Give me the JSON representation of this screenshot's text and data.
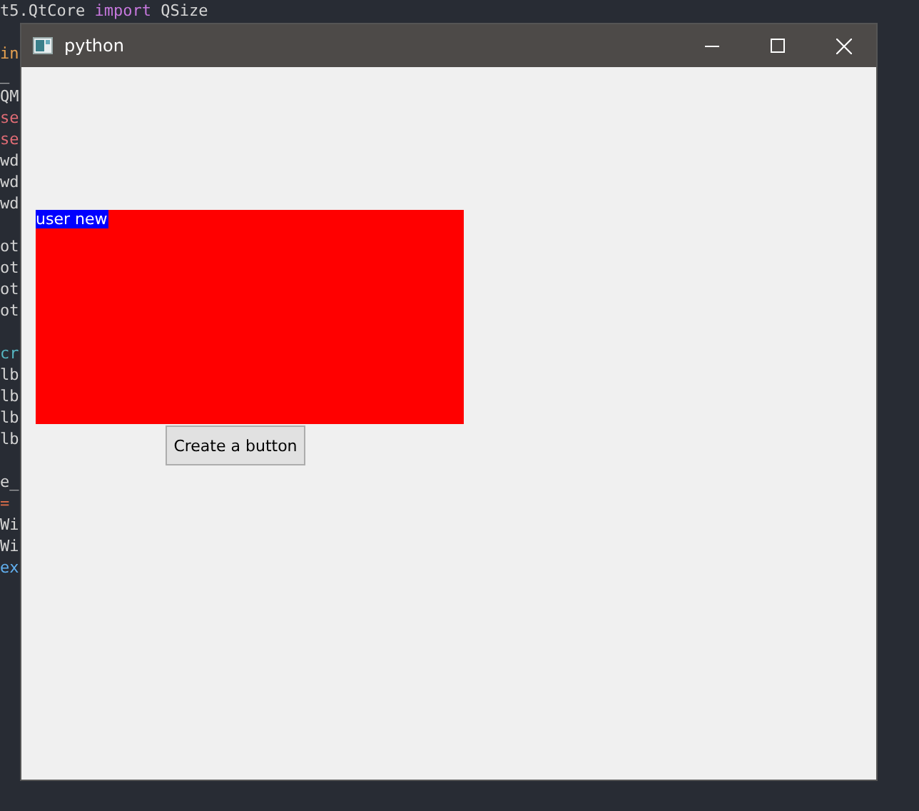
{
  "editor": {
    "first_line": [
      {
        "text": "t5.QtCore ",
        "color": "#d4d4d4"
      },
      {
        "text": "import",
        "color": "#c678dd"
      },
      {
        "text": " QSize",
        "color": "#d4d4d4"
      }
    ],
    "lines": [
      {
        "kind": "blank"
      },
      {
        "kind": "code",
        "text": "in",
        "color": "#e5a050"
      },
      {
        "kind": "code",
        "text": "_"
      },
      {
        "kind": "code",
        "text": "QM",
        "color": "#d4d4d4"
      },
      {
        "kind": "code",
        "text": "se",
        "color": "#e06c75"
      },
      {
        "kind": "code",
        "text": "se",
        "color": "#e06c75"
      },
      {
        "kind": "code",
        "text": "wd",
        "color": "#d4d4d4"
      },
      {
        "kind": "code",
        "text": "wd",
        "color": "#d4d4d4"
      },
      {
        "kind": "code",
        "text": "wd",
        "color": "#d4d4d4"
      },
      {
        "kind": "blank"
      },
      {
        "kind": "code",
        "text": "ot",
        "color": "#d4d4d4"
      },
      {
        "kind": "code",
        "text": "ot",
        "color": "#d4d4d4"
      },
      {
        "kind": "code",
        "text": "ot",
        "color": "#d4d4d4"
      },
      {
        "kind": "code",
        "text": "ot",
        "color": "#d4d4d4"
      },
      {
        "kind": "blank"
      },
      {
        "kind": "code",
        "text": "cr",
        "color": "#56b6c2"
      },
      {
        "kind": "code",
        "text": "lb",
        "color": "#d4d4d4"
      },
      {
        "kind": "code",
        "text": "lb",
        "color": "#d4d4d4"
      },
      {
        "kind": "code",
        "text": "lb",
        "color": "#d4d4d4"
      },
      {
        "kind": "code",
        "text": "lb",
        "color": "#d4d4d4"
      },
      {
        "kind": "blank"
      },
      {
        "kind": "code",
        "text": "e_",
        "color": "#d4d4d4"
      },
      {
        "kind": "code",
        "text": "=",
        "color": "#e5704b"
      },
      {
        "kind": "code",
        "text": "Wi",
        "color": "#d4d4d4"
      },
      {
        "kind": "code",
        "text": "Wi",
        "color": "#d4d4d4"
      },
      {
        "kind": "code",
        "text": "ex",
        "color": "#61afef"
      }
    ]
  },
  "window": {
    "title": "python",
    "label": {
      "text": "user new"
    },
    "button": "Create a button"
  }
}
